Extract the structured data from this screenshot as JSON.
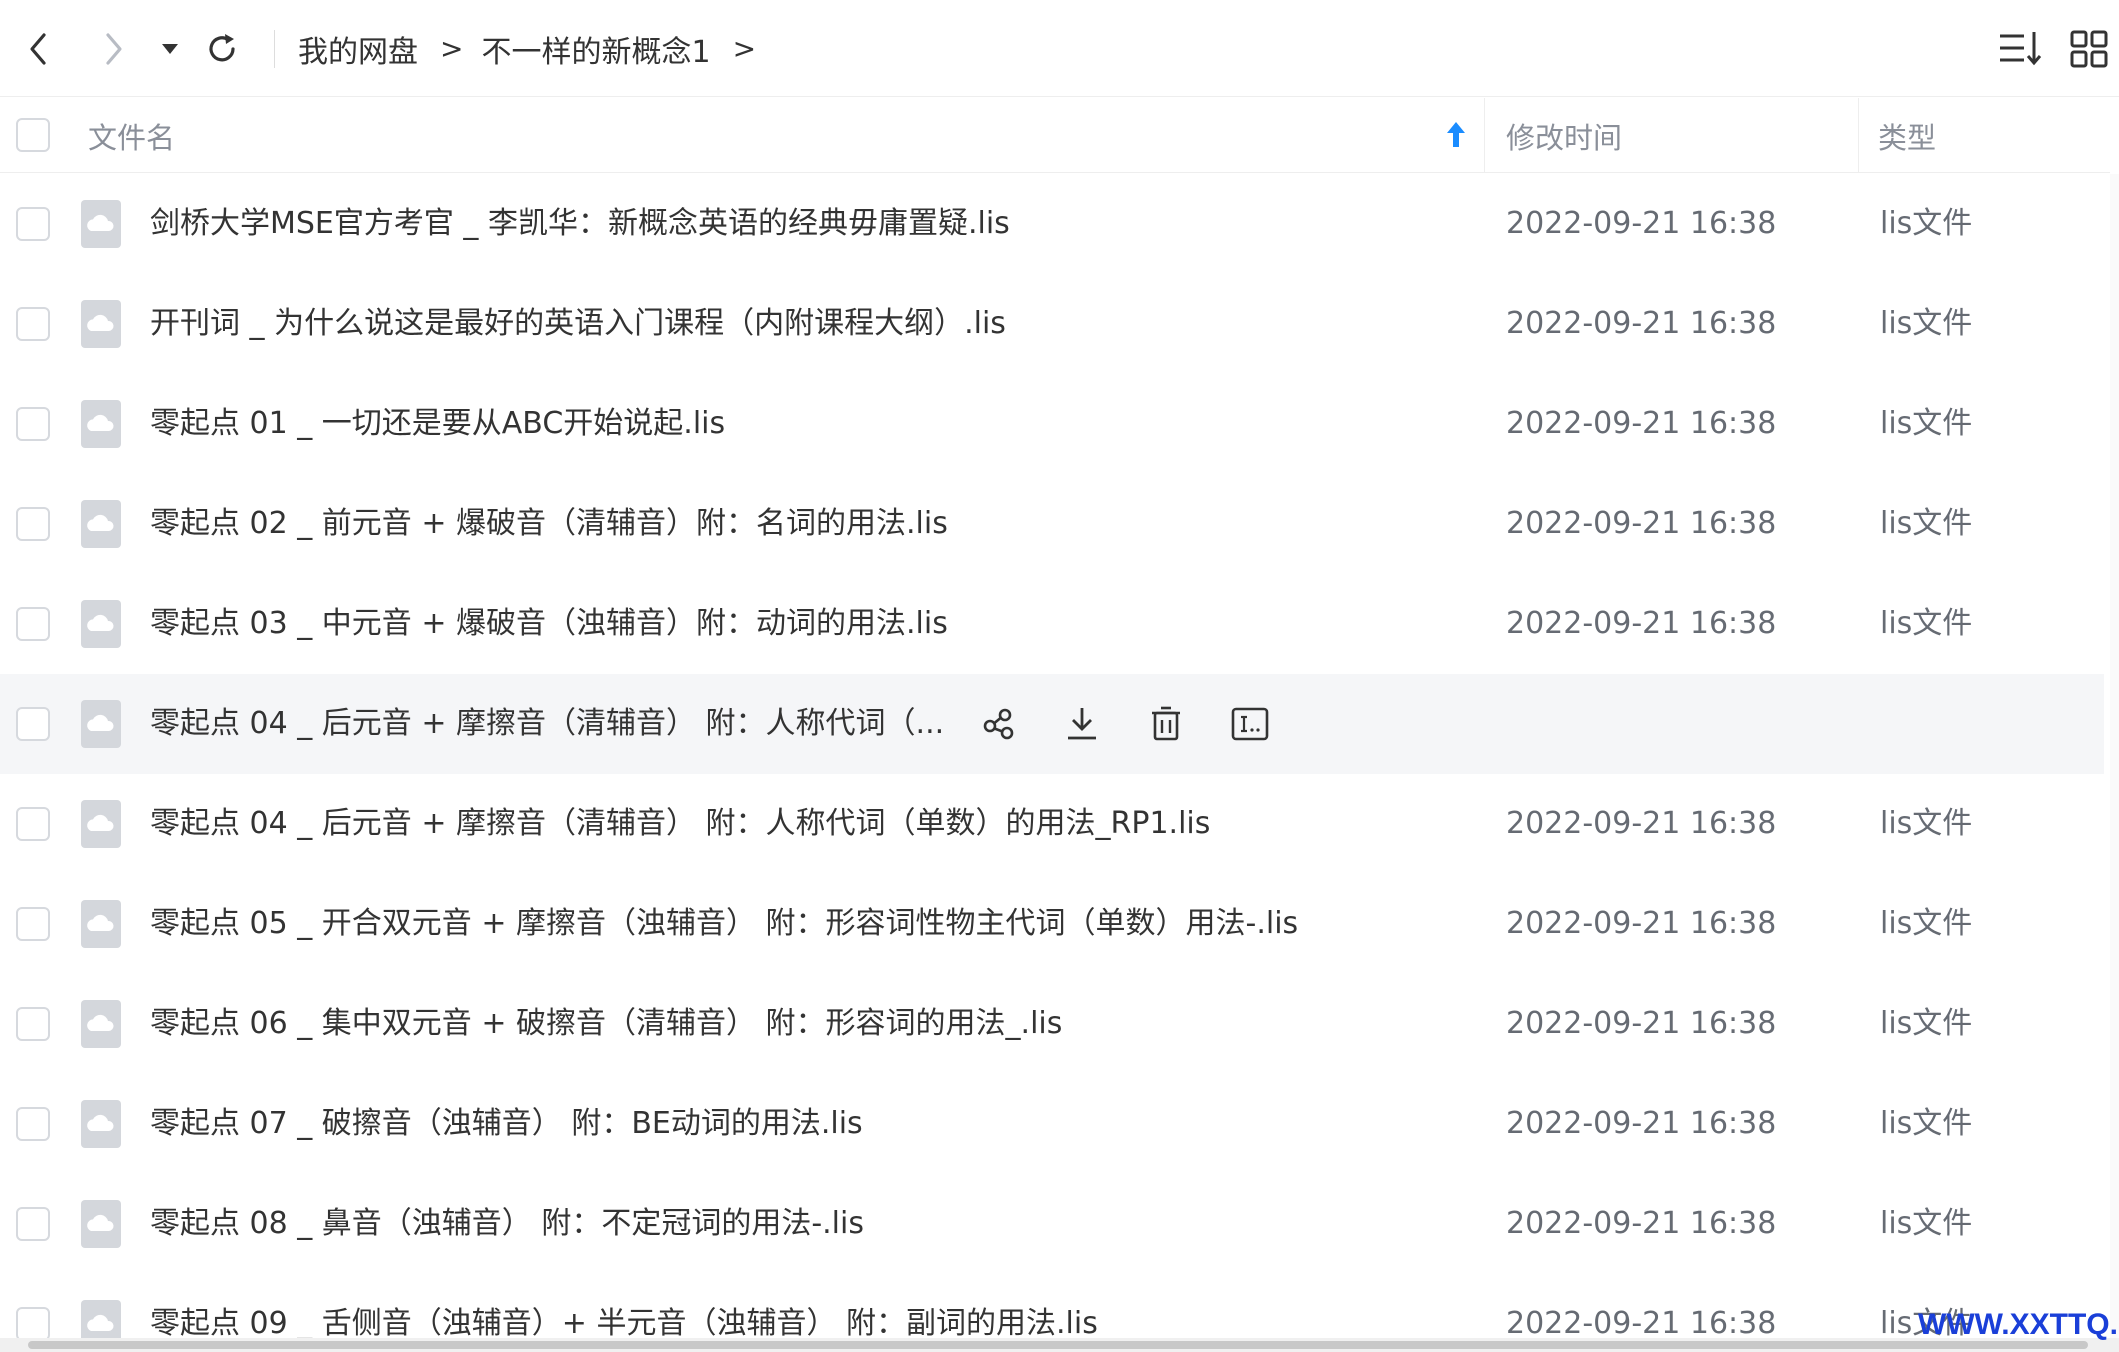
{
  "toolbar": {
    "breadcrumb": [
      {
        "label": "我的网盘"
      },
      {
        "label": "不一样的新概念1"
      }
    ],
    "separator": ">",
    "icons": {
      "back": "chevron-left-icon",
      "forward": "chevron-right-icon",
      "dropdown": "caret-down-icon",
      "refresh": "refresh-icon",
      "sort": "sort-list-icon",
      "view": "grid-view-icon"
    }
  },
  "header": {
    "name": "文件名",
    "time": "修改时间",
    "type": "类型"
  },
  "files": [
    {
      "name": "剑桥大学MSE官方考官 _ 李凯华：新概念英语的经典毋庸置疑.lis",
      "time": "2022-09-21 16:38",
      "type": "lis文件"
    },
    {
      "name": "开刊词 _ 为什么说这是最好的英语入门课程（内附课程大纲）.lis",
      "time": "2022-09-21 16:38",
      "type": "lis文件"
    },
    {
      "name": "零起点 01 _ 一切还是要从ABC开始说起.lis",
      "time": "2022-09-21 16:38",
      "type": "lis文件"
    },
    {
      "name": "零起点 02 _ 前元音 + 爆破音（清辅音）附：名词的用法.lis",
      "time": "2022-09-21 16:38",
      "type": "lis文件"
    },
    {
      "name": "零起点 03 _ 中元音 + 爆破音（浊辅音）附：动词的用法.lis",
      "time": "2022-09-21 16:38",
      "type": "lis文件"
    },
    {
      "name": "零起点 04 _ 后元音 + 摩擦音（清辅音） 附：人称代词（...",
      "time": "",
      "type": "",
      "hovered": true
    },
    {
      "name": "零起点 04 _ 后元音 + 摩擦音（清辅音） 附：人称代词（单数）的用法_RP1.lis",
      "time": "2022-09-21 16:38",
      "type": "lis文件"
    },
    {
      "name": "零起点 05 _ 开合双元音 + 摩擦音（浊辅音） 附：形容词性物主代词（单数）用法-.lis",
      "time": "2022-09-21 16:38",
      "type": "lis文件"
    },
    {
      "name": "零起点 06 _ 集中双元音 + 破擦音（清辅音） 附：形容词的用法_.lis",
      "time": "2022-09-21 16:38",
      "type": "lis文件"
    },
    {
      "name": "零起点 07 _ 破擦音（浊辅音） 附：BE动词的用法.lis",
      "time": "2022-09-21 16:38",
      "type": "lis文件"
    },
    {
      "name": "零起点 08 _ 鼻音（浊辅音） 附：不定冠词的用法-.lis",
      "time": "2022-09-21 16:38",
      "type": "lis文件"
    },
    {
      "name": "零起点 09 _ 舌侧音（浊辅音）+ 半元音（浊辅音） 附：副词的用法.lis",
      "time": "2022-09-21 16:38",
      "type": "lis文件"
    }
  ],
  "row_actions": [
    "share-icon",
    "download-icon",
    "delete-icon",
    "rename-icon"
  ],
  "watermark": "WWW.XXTTQ.COM",
  "colors": {
    "accent": "#1a8cff",
    "hover_row": "#f5f6f8",
    "watermark": "#1a3fd8"
  }
}
